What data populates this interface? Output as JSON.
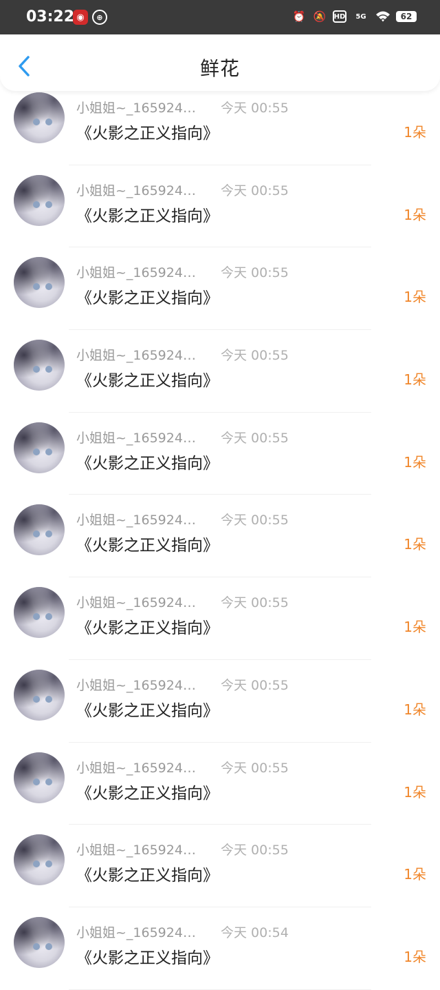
{
  "status_bar": {
    "time": "03:22",
    "icons": [
      "netease-music-icon",
      "app-icon",
      "alarm-icon",
      "mute-icon",
      "hd-icon",
      "5g-signal-icon",
      "wifi-icon",
      "battery-icon"
    ],
    "hd_label": "HD",
    "network_label": "5G",
    "battery": "62"
  },
  "header": {
    "title": "鲜花",
    "back_icon": "chevron-left-icon",
    "accent_color": "#2f9bef"
  },
  "records": [
    {
      "user": "小姐姐~_165924…",
      "time": "今天 00:55",
      "title": "《火影之正义指向》",
      "count": "1朵"
    },
    {
      "user": "小姐姐~_165924…",
      "time": "今天 00:55",
      "title": "《火影之正义指向》",
      "count": "1朵"
    },
    {
      "user": "小姐姐~_165924…",
      "time": "今天 00:55",
      "title": "《火影之正义指向》",
      "count": "1朵"
    },
    {
      "user": "小姐姐~_165924…",
      "time": "今天 00:55",
      "title": "《火影之正义指向》",
      "count": "1朵"
    },
    {
      "user": "小姐姐~_165924…",
      "time": "今天 00:55",
      "title": "《火影之正义指向》",
      "count": "1朵"
    },
    {
      "user": "小姐姐~_165924…",
      "time": "今天 00:55",
      "title": "《火影之正义指向》",
      "count": "1朵"
    },
    {
      "user": "小姐姐~_165924…",
      "time": "今天 00:55",
      "title": "《火影之正义指向》",
      "count": "1朵"
    },
    {
      "user": "小姐姐~_165924…",
      "time": "今天 00:55",
      "title": "《火影之正义指向》",
      "count": "1朵"
    },
    {
      "user": "小姐姐~_165924…",
      "time": "今天 00:55",
      "title": "《火影之正义指向》",
      "count": "1朵"
    },
    {
      "user": "小姐姐~_165924…",
      "time": "今天 00:55",
      "title": "《火影之正义指向》",
      "count": "1朵"
    },
    {
      "user": "小姐姐~_165924…",
      "time": "今天 00:54",
      "title": "《火影之正义指向》",
      "count": "1朵"
    }
  ],
  "colors": {
    "count": "#f0862a",
    "status_bar_bg": "#3a3a3a"
  }
}
